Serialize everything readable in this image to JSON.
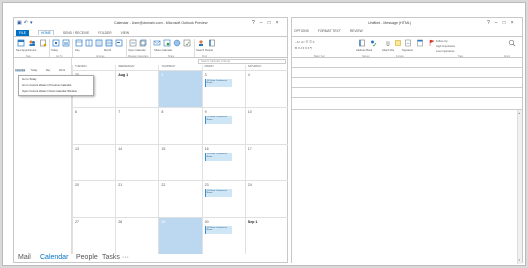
{
  "calendar_window": {
    "title": "Calendar - User@domain.com - Microsoft Outlook Preview",
    "controls": [
      "?",
      "–",
      "□",
      "×"
    ],
    "quick_access": [
      "▣",
      "↶",
      "▾"
    ],
    "tabs": [
      "FILE",
      "HOME",
      "SEND / RECEIVE",
      "FOLDER",
      "VIEW"
    ],
    "active_tab": "HOME",
    "ribbon_items": [
      "New Appointment",
      "New Meeting",
      "New Items",
      "Today",
      "Next 7 Days",
      "Day",
      "Work Week",
      "Week",
      "Month",
      "Schedule View",
      "Open Calendar",
      "Calendar Groups",
      "E-mail Calendar",
      "Share Calendar",
      "Publish Online",
      "Calendar Permissions",
      "Search People",
      "Address Book"
    ],
    "ribbon_groups": [
      "New",
      "Go To",
      "Arrange",
      "Manage Calendars",
      "Share",
      "Find"
    ],
    "left_pane": {
      "labels": [
        "Calendar",
        "Today",
        "Day",
        "Work"
      ],
      "selected": "Calendar"
    },
    "dropdown_menu": [
      "Go to Today",
      "Go to Current Week in Previous Calendar",
      "Open Current Week in New Calendar Window"
    ],
    "search_placeholder": "Search Calendar (Ctrl+E)",
    "day_headers": [
      "TUESDAY",
      "WEDNESDAY",
      "THURSDAY",
      "FRIDAY",
      "SATURDAY"
    ],
    "weeks": [
      [
        {
          "n": "30",
          "bold": false
        },
        {
          "n": "Aug 1",
          "bold": true
        },
        {
          "n": "2",
          "bold": false,
          "today": true
        },
        {
          "n": "3",
          "bold": false,
          "appt": "12:00am Conference Room"
        },
        {
          "n": "4",
          "bold": false
        }
      ],
      [
        {
          "n": "6",
          "bold": false
        },
        {
          "n": "7",
          "bold": false
        },
        {
          "n": "8",
          "bold": false
        },
        {
          "n": "9",
          "bold": false,
          "appt": "12:00am Conference Room"
        },
        {
          "n": "10",
          "bold": false
        }
      ],
      [
        {
          "n": "13",
          "bold": false
        },
        {
          "n": "14",
          "bold": false
        },
        {
          "n": "15",
          "bold": false
        },
        {
          "n": "16",
          "bold": false,
          "appt": "12:00am Conference Room"
        },
        {
          "n": "17",
          "bold": false
        }
      ],
      [
        {
          "n": "20",
          "bold": false
        },
        {
          "n": "21",
          "bold": false
        },
        {
          "n": "22",
          "bold": false
        },
        {
          "n": "23",
          "bold": false,
          "appt": "12:00am Conference Room"
        },
        {
          "n": "24",
          "bold": false
        }
      ],
      [
        {
          "n": "27",
          "bold": false
        },
        {
          "n": "28",
          "bold": false
        },
        {
          "n": "29",
          "bold": false,
          "today": true
        },
        {
          "n": "30",
          "bold": false,
          "appt": "12:00am Conference Room"
        },
        {
          "n": "Sep 1",
          "bold": true
        }
      ]
    ],
    "nav": [
      "Mail",
      "Calendar",
      "People",
      "Tasks",
      "···"
    ],
    "nav_active": "Calendar"
  },
  "message_window": {
    "title": "Untitled - Message (HTML)",
    "controls": [
      "?",
      "–",
      "□",
      "×"
    ],
    "tabs": [
      "OPTIONS",
      "FORMAT TEXT",
      "REVIEW"
    ],
    "ribbon_items": [
      "Address Book",
      "Check Names",
      "Attach File",
      "Attach Item",
      "Signature",
      "Assign Policy",
      "Follow Up",
      "High Importance",
      "Low Importance",
      "Zoom"
    ],
    "ribbon_groups": [
      "Basic Text",
      "Names",
      "Include",
      "Tags",
      "Zoom"
    ],
    "format_line1": "- A˄ A˅  ☰ ☰  ≡",
    "format_line2": "B I U  ≡ ≡ ≡  ¶"
  }
}
